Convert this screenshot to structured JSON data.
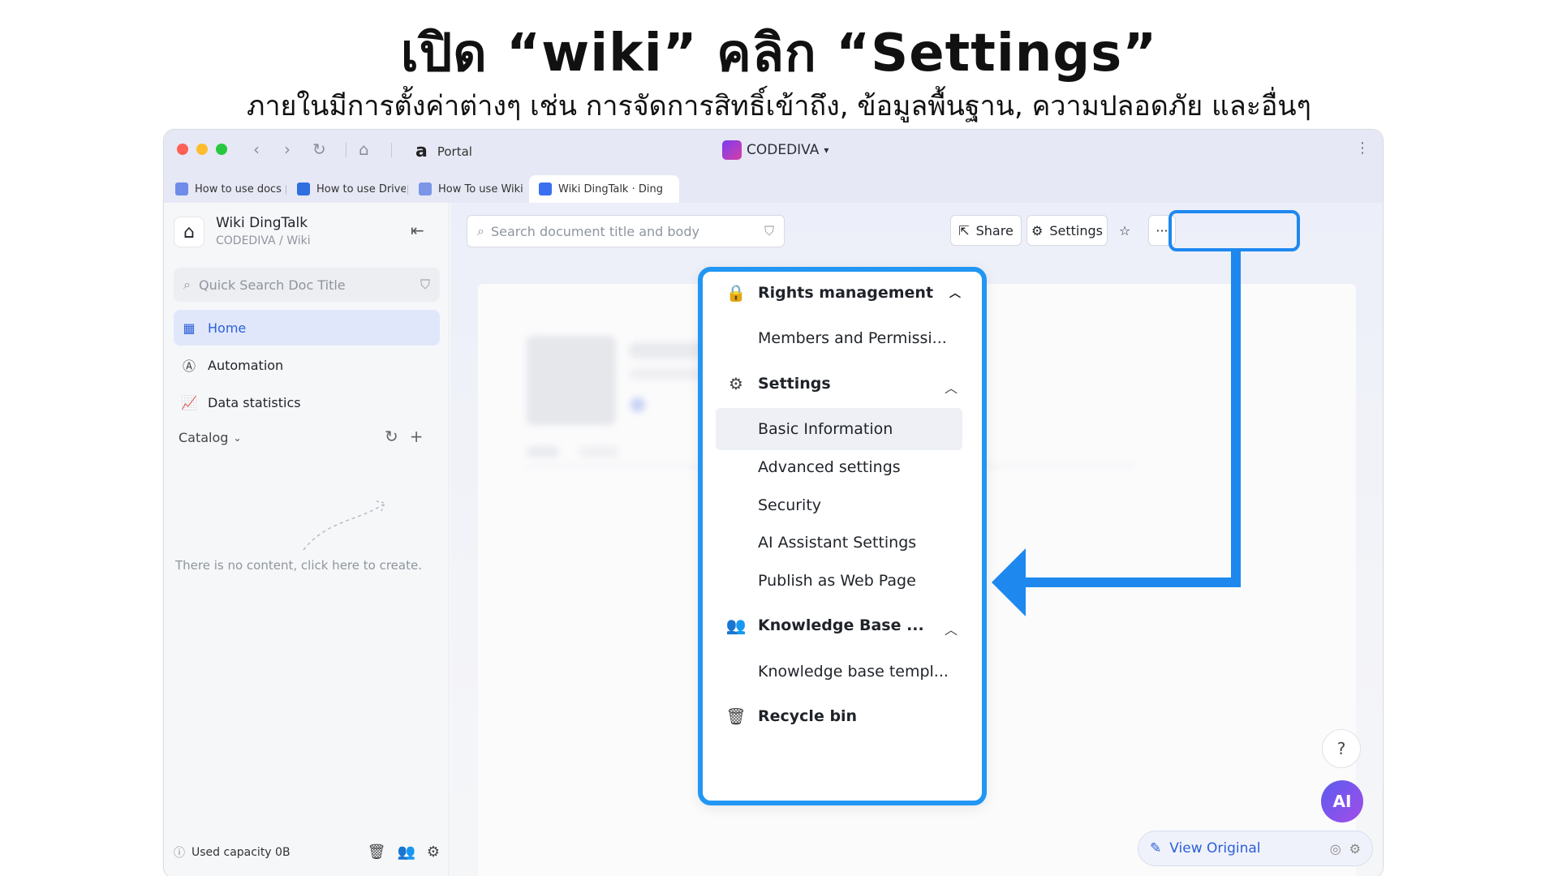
{
  "annotation": {
    "title": "เปิด “wiki” คลิก “Settings”",
    "subtitle": "ภายในมีการตั้งค่าต่างๆ เช่น การจัดการสิทธิ์เข้าถึง, ข้อมูลพื้นฐาน, ความปลอดภัย และอื่นๆ",
    "highlight_color": "#1E88EF"
  },
  "titlebar": {
    "portal_label": "Portal",
    "portal_logo": "a",
    "brand": "CODEDIVA",
    "brand_caret": "▾"
  },
  "tabs": [
    {
      "label": "How to use docs in D"
    },
    {
      "label": "How to use Drive in D"
    },
    {
      "label": "How To use Wiki in D"
    },
    {
      "label": "Wiki DingTalk · Ding"
    }
  ],
  "sidebar": {
    "wiki_title": "Wiki DingTalk",
    "breadcrumb": "CODEDIVA  /  Wiki",
    "search_placeholder": "Quick Search Doc Title",
    "nav": [
      {
        "label": "Home",
        "icon": "grid-icon",
        "active": true
      },
      {
        "label": "Automation",
        "icon": "automation-icon"
      },
      {
        "label": "Data statistics",
        "icon": "chart-icon"
      }
    ],
    "catalog_label": "Catalog",
    "empty_text": "There is no content, click here to create.",
    "capacity": "Used capacity 0B"
  },
  "toolbar": {
    "search_placeholder": "Search document title and body",
    "share_label": "Share",
    "settings_label": "Settings",
    "more_label": "···"
  },
  "dropdown": {
    "rights_header": "Rights management",
    "members_item": "Members and Permissi...",
    "settings_header": "Settings",
    "settings_items": [
      "Basic Information",
      "Advanced settings",
      "Security",
      "AI Assistant Settings",
      "Publish as Web Page"
    ],
    "kb_header": "Knowledge Base ...",
    "kb_item": "Knowledge base templ...",
    "recycle": "Recycle bin"
  },
  "floating": {
    "help": "?",
    "ai": "AI",
    "view_original": "View Original"
  }
}
